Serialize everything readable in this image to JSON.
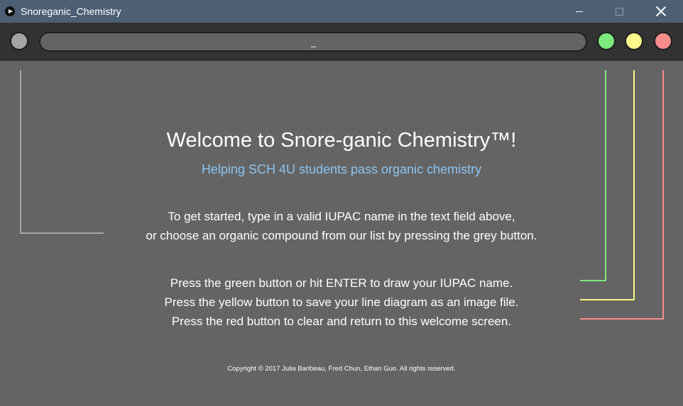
{
  "window": {
    "title": "Snoreganic_Chemistry"
  },
  "toolbar": {
    "input_value": "",
    "input_cursor": "_",
    "buttons": {
      "list": {
        "color": "#a4a4a4"
      },
      "draw": {
        "color": "#7dea7d"
      },
      "save": {
        "color": "#fbf78a"
      },
      "clear": {
        "color": "#f78c8c"
      }
    }
  },
  "welcome": {
    "headline": "Welcome to Snore-ganic Chemistry™!",
    "subtitle": "Helping SCH 4U students pass organic chemistry",
    "intro_lines": [
      "To get started, type in a valid IUPAC name in the text field above,",
      "or choose an organic compound from our list by pressing the grey button."
    ],
    "instructions": [
      "Press the green button or hit ENTER to draw your IUPAC name.",
      "Press the yellow button to save your line diagram as an image file.",
      "Press the red button to clear and return to this welcome screen."
    ],
    "copyright": "Copyright © 2017 Julia Baribeau, Fred Chun, Ethan Guo. All rights reserved."
  },
  "colors": {
    "background": "#646464",
    "toolbar": "#323232",
    "titlebar": "#4c5f74",
    "subtitle": "#8cc4f0",
    "guide_grey": "#a4a4a4",
    "guide_green": "#7dea7d",
    "guide_yellow": "#fbf78a",
    "guide_red": "#f78c8c"
  }
}
